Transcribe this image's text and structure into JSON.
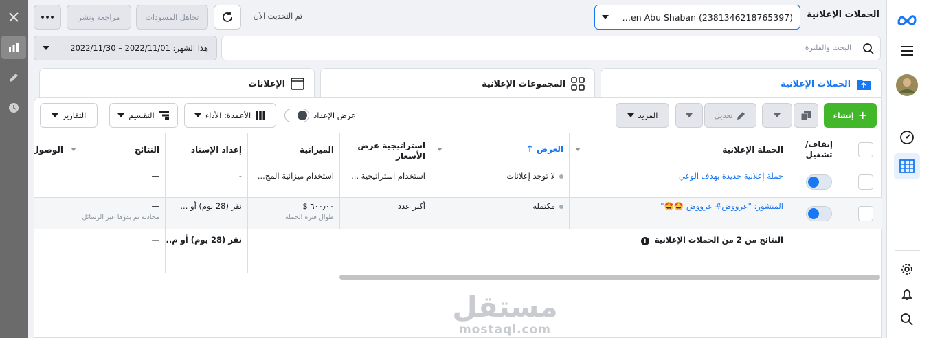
{
  "top": {
    "title": "الحملات الإعلانية",
    "account_value": "en Abu Shaban (2381346218765397)…",
    "updated_text": "تم التحديث الآن",
    "discard_drafts": "تجاهل المسودات",
    "review_publish": "مراجعة ونشر",
    "more_glyph": "•••"
  },
  "search": {
    "placeholder": "البحث والفلترة",
    "date_label": "هذا الشهر: 2022/11/01 – 2022/11/30"
  },
  "tabs": {
    "campaigns": "الحملات الإعلانية",
    "adsets": "المجموعات الإعلانية",
    "ads": "الإعلانات"
  },
  "toolbar": {
    "create": "إنشاء",
    "edit": "تعديل",
    "more": "المزيد",
    "view_setup": "عرض الإعداد",
    "columns": "الأعمدة: الأداء",
    "breakdown": "التقسيم",
    "reports": "التقارير"
  },
  "table": {
    "headers": {
      "onoff": "إيقاف/ تشغيل",
      "campaign": "الحملة الإعلانية",
      "delivery": "العرض",
      "bid_strategy": "استراتيجية عرض الأسعار",
      "budget": "الميزانية",
      "attribution": "إعداد الإسناد",
      "results": "النتائج",
      "reach": "الوصول"
    },
    "rows": [
      {
        "campaign": "حملة إعلانية جديدة بهدف الوعي",
        "delivery": "لا توجد إعلانات",
        "bid_strategy": "استخدام استراتيجية ...",
        "budget": "استخدام ميزانية المج...",
        "budget_sub": "",
        "attribution": "-",
        "results": "—",
        "results_sub": ""
      },
      {
        "campaign": "المنشور: \"عرووض# عرووض 🤩🤩\"",
        "delivery": "مكتملة",
        "bid_strategy": "أكبر عدد",
        "budget": "٦٠٠٫٠٠ $",
        "budget_sub": "طوال فترة الحملة",
        "attribution": "نقر (28 يوم) أو ...",
        "results": "—",
        "results_sub": "محادثة تم بدؤها عبر الرسائل"
      }
    ],
    "summary": {
      "label": "النتائج من 2 من الحملات الإعلانية",
      "attribution": "نقر (28 يوم) أو م...",
      "results": "—"
    }
  },
  "watermark": {
    "arabic": "مستقل",
    "latin": "mostaql.com"
  },
  "colors": {
    "accent": "#1877f2",
    "create_green": "#42b72a"
  }
}
